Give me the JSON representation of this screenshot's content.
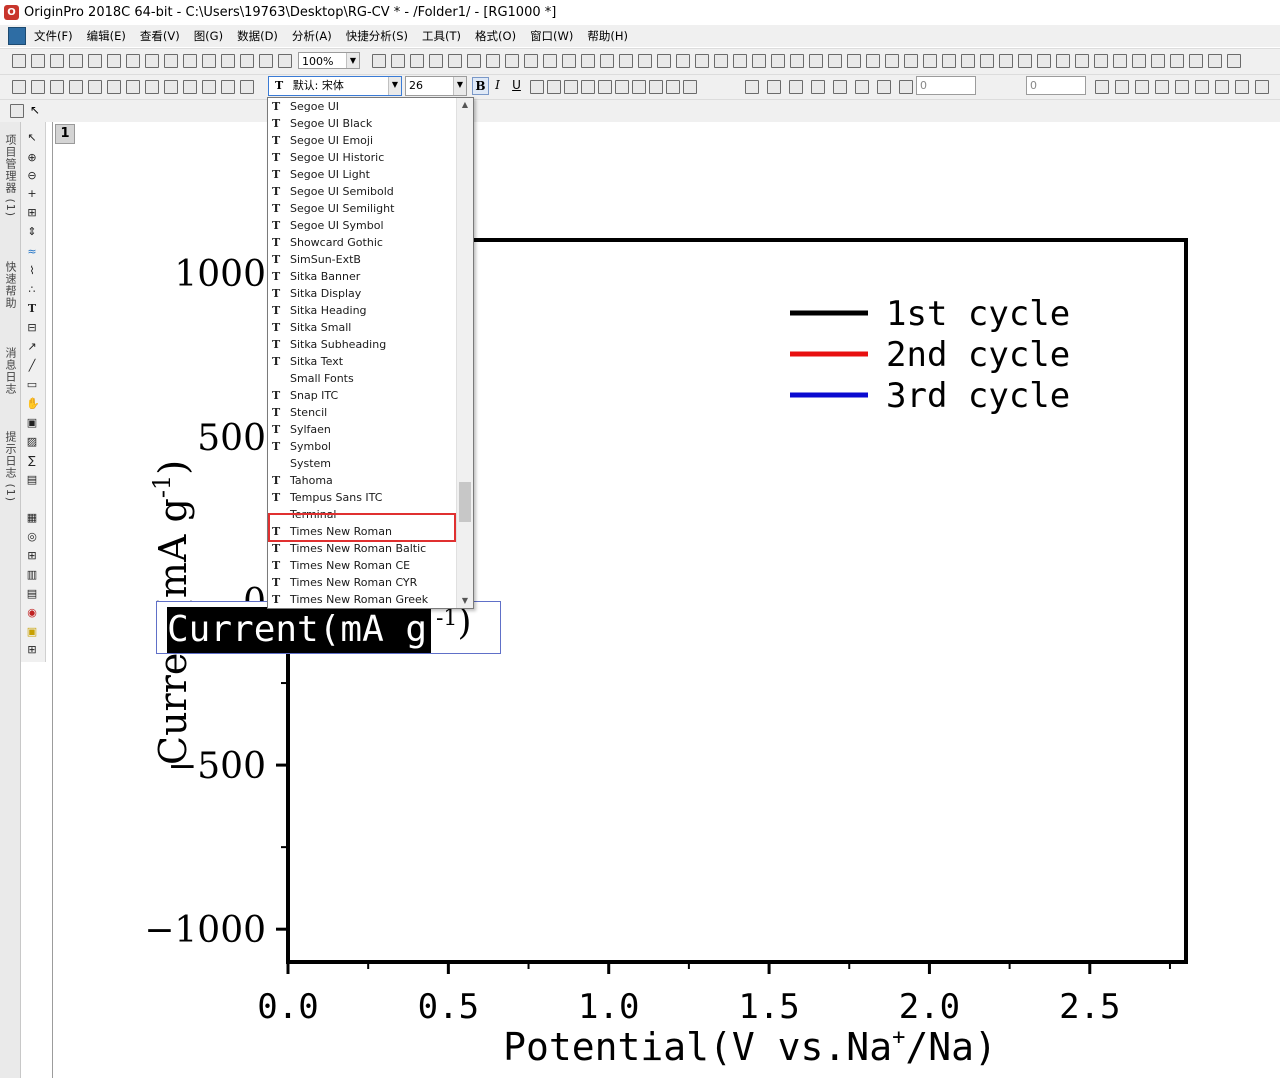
{
  "window": {
    "title": "OriginPro 2018C 64-bit - C:\\Users\\19763\\Desktop\\RG-CV * - /Folder1/ - [RG1000 *]"
  },
  "menu": [
    "文件(F)",
    "编辑(E)",
    "查看(V)",
    "图(G)",
    "数据(D)",
    "分析(A)",
    "快捷分析(S)",
    "工具(T)",
    "格式(O)",
    "窗口(W)",
    "帮助(H)"
  ],
  "toolbar": {
    "zoom": "100%",
    "font_name": "默认: 宋体",
    "font_size": "26",
    "bold": "B",
    "italic": "I",
    "underline": "U",
    "line_value_1": "0",
    "line_value_2": "0"
  },
  "side_tabs": [
    "项目管理器 (1)",
    "快速帮助",
    "消息日志",
    "提示日志 (1)"
  ],
  "layer": {
    "number": "1"
  },
  "font_dropdown": {
    "items": [
      {
        "name": "Segoe UI",
        "tt": true
      },
      {
        "name": "Segoe UI Black",
        "tt": true
      },
      {
        "name": "Segoe UI Emoji",
        "tt": true
      },
      {
        "name": "Segoe UI Historic",
        "tt": true
      },
      {
        "name": "Segoe UI Light",
        "tt": true
      },
      {
        "name": "Segoe UI Semibold",
        "tt": true
      },
      {
        "name": "Segoe UI Semilight",
        "tt": true
      },
      {
        "name": "Segoe UI Symbol",
        "tt": true
      },
      {
        "name": "Showcard Gothic",
        "tt": true
      },
      {
        "name": "SimSun-ExtB",
        "tt": true
      },
      {
        "name": "Sitka Banner",
        "tt": true
      },
      {
        "name": "Sitka Display",
        "tt": true
      },
      {
        "name": "Sitka Heading",
        "tt": true
      },
      {
        "name": "Sitka Small",
        "tt": true
      },
      {
        "name": "Sitka Subheading",
        "tt": true
      },
      {
        "name": "Sitka Text",
        "tt": true
      },
      {
        "name": "Small Fonts",
        "tt": false
      },
      {
        "name": "Snap ITC",
        "tt": true
      },
      {
        "name": "Stencil",
        "tt": true
      },
      {
        "name": "Sylfaen",
        "tt": true
      },
      {
        "name": "Symbol",
        "tt": true
      },
      {
        "name": "System",
        "tt": false
      },
      {
        "name": "Tahoma",
        "tt": true
      },
      {
        "name": "Tempus Sans ITC",
        "tt": true
      },
      {
        "name": "Terminal",
        "tt": false
      },
      {
        "name": "Times New Roman",
        "tt": true
      },
      {
        "name": "Times New Roman Baltic",
        "tt": true
      },
      {
        "name": "Times New Roman CE",
        "tt": true
      },
      {
        "name": "Times New Roman CYR",
        "tt": true
      },
      {
        "name": "Times New Roman Greek",
        "tt": true
      }
    ],
    "highlighted": "Times New Roman"
  },
  "ylabel_editor": {
    "selected_text": "Current(mA g",
    "superscript": "-1",
    "close": ")"
  },
  "chart_data": {
    "type": "line",
    "xlabel_main": "Potential(V vs.Na",
    "xlabel_sup": "+",
    "xlabel_tail": "/Na)",
    "ylabel": "Current(mA g",
    "ylabel_sup": "-1",
    "ylabel_close": ")",
    "xlim": [
      0.0,
      2.8
    ],
    "ylim": [
      -1100,
      1100
    ],
    "x_ticks": [
      {
        "value": 0.0,
        "label": "0.0"
      },
      {
        "value": 0.5,
        "label": "0.5"
      },
      {
        "value": 1.0,
        "label": "1.0"
      },
      {
        "value": 1.5,
        "label": "1.5"
      },
      {
        "value": 2.0,
        "label": "2.0"
      },
      {
        "value": 2.5,
        "label": "2.5"
      }
    ],
    "y_ticks": [
      {
        "value": 1000,
        "label": "1000"
      },
      {
        "value": 500,
        "label": "500"
      },
      {
        "value": 0,
        "label": "0"
      },
      {
        "value": -500,
        "label": "−500"
      },
      {
        "value": -1000,
        "label": "−1000"
      }
    ],
    "legend_placement": "top-right",
    "series": [
      {
        "name": "1st cycle",
        "color": "#000000",
        "x": [],
        "y": []
      },
      {
        "name": "2nd cycle",
        "color": "#e81010",
        "x": [],
        "y": []
      },
      {
        "name": "3rd cycle",
        "color": "#0a0ad0",
        "x": [],
        "y": []
      }
    ]
  }
}
